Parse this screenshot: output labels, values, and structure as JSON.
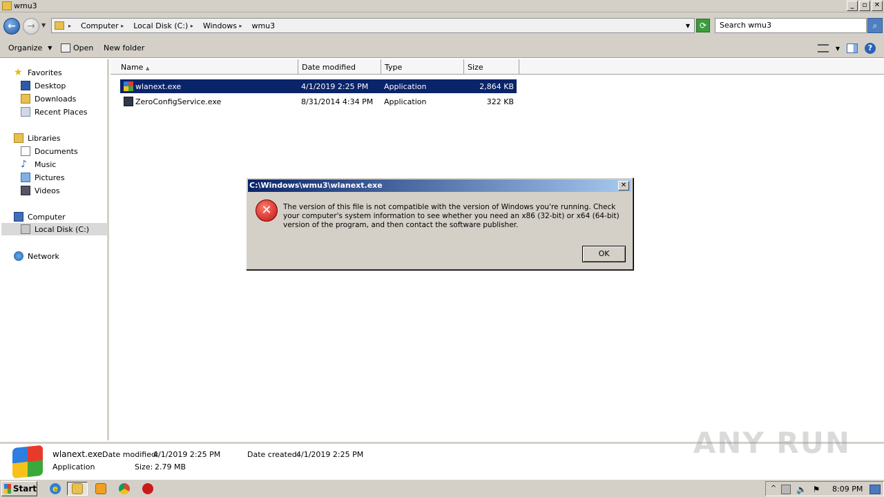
{
  "window": {
    "title": "wmu3"
  },
  "address": {
    "crumbs": [
      "Computer",
      "Local Disk (C:)",
      "Windows",
      "wmu3"
    ],
    "search_placeholder": "Search wmu3"
  },
  "toolbar": {
    "organize": "Organize",
    "open": "Open",
    "new_folder": "New folder"
  },
  "sidebar": {
    "favorites": "Favorites",
    "desktop": "Desktop",
    "downloads": "Downloads",
    "recent": "Recent Places",
    "libraries": "Libraries",
    "documents": "Documents",
    "music": "Music",
    "pictures": "Pictures",
    "videos": "Videos",
    "computer": "Computer",
    "local_disk": "Local Disk (C:)",
    "network": "Network"
  },
  "columns": {
    "name": "Name",
    "date": "Date modified",
    "type": "Type",
    "size": "Size"
  },
  "files": [
    {
      "name": "wlanext.exe",
      "date": "4/1/2019 2:25 PM",
      "type": "Application",
      "size": "2,864 KB"
    },
    {
      "name": "ZeroConfigService.exe",
      "date": "8/31/2014 4:34 PM",
      "type": "Application",
      "size": "322 KB"
    }
  ],
  "details": {
    "filename": "wlanext.exe",
    "date_modified_label": "Date modified:",
    "date_modified": "4/1/2019 2:25 PM",
    "date_created_label": "Date created:",
    "date_created": "4/1/2019 2:25 PM",
    "type": "Application",
    "size_label": "Size:",
    "size": "2.79 MB",
    "watermark": "ANY RUN"
  },
  "dialog": {
    "title": "C:\\Windows\\wmu3\\wlanext.exe",
    "message": "The version of this file is not compatible with the version of Windows you're running. Check your computer's system information to see whether you need an x86 (32-bit) or x64 (64-bit) version of the program, and then contact the software publisher.",
    "ok": "OK"
  },
  "taskbar": {
    "start": "Start",
    "clock": "8:09 PM"
  }
}
